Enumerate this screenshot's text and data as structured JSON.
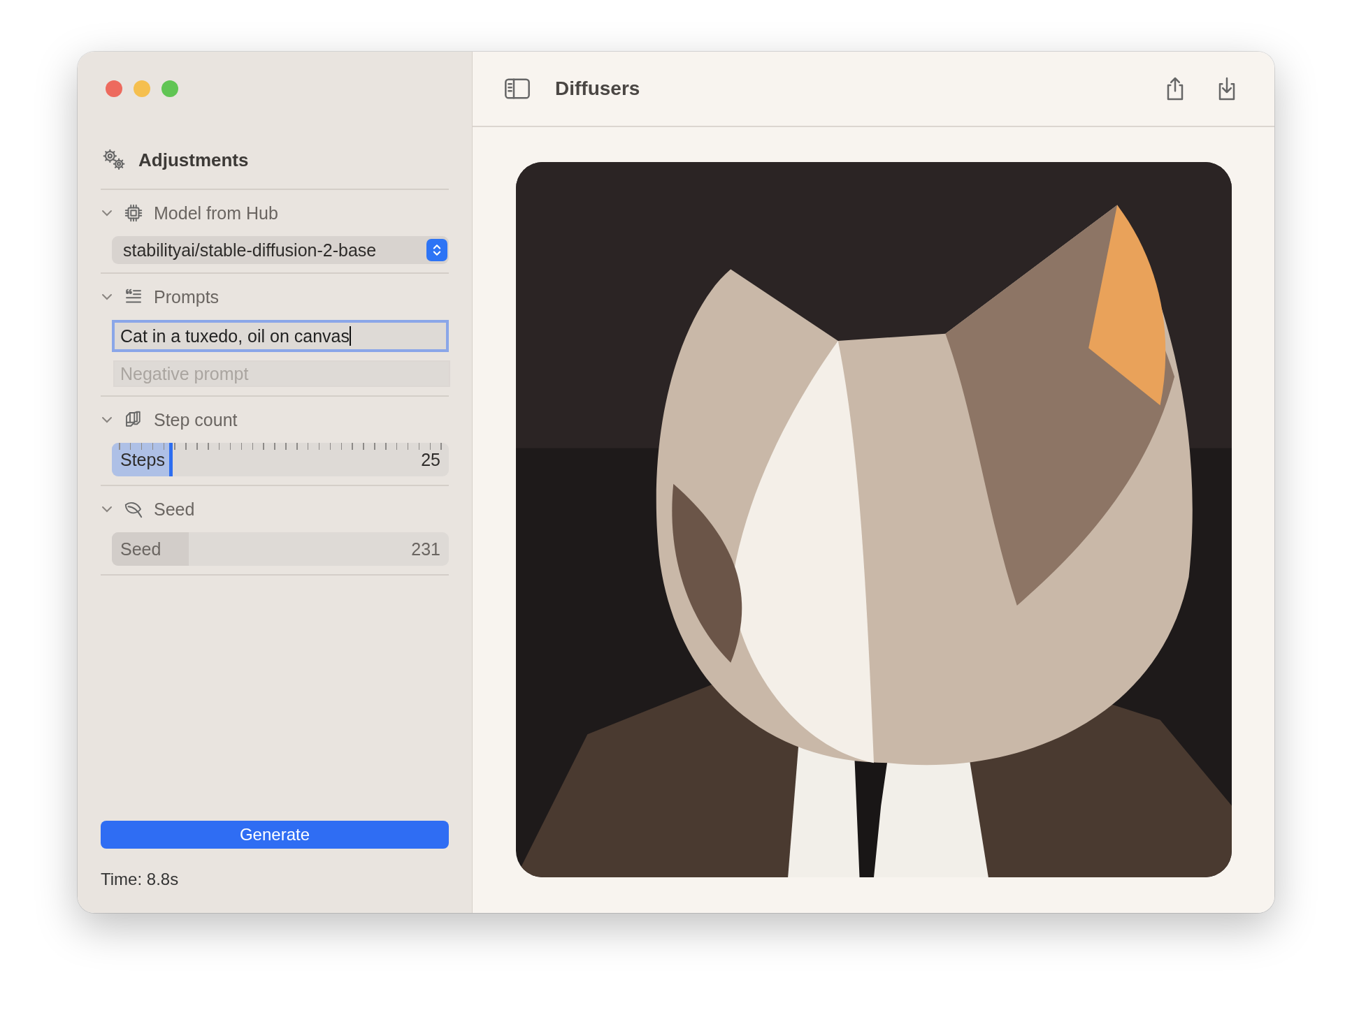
{
  "window": {
    "title": "Diffusers"
  },
  "sidebar": {
    "title": "Adjustments",
    "sections": [
      {
        "kind": "picker",
        "title": "Model from Hub",
        "expanded": true,
        "value": "stabilityai/stable-diffusion-2-base"
      },
      {
        "kind": "prompts",
        "title": "Prompts",
        "expanded": true,
        "prompt": {
          "value": "Cat in a tuxedo, oil on canvas",
          "focused": true
        },
        "negative": {
          "placeholder": "Negative prompt"
        }
      },
      {
        "kind": "slider",
        "title": "Step count",
        "expanded": true,
        "label": "Steps",
        "value": "25",
        "level": 0.17
      },
      {
        "kind": "number",
        "title": "Seed",
        "expanded": true,
        "label": "Seed",
        "value": "231"
      }
    ],
    "generate": "Generate",
    "time": "Time: 8.8s"
  }
}
